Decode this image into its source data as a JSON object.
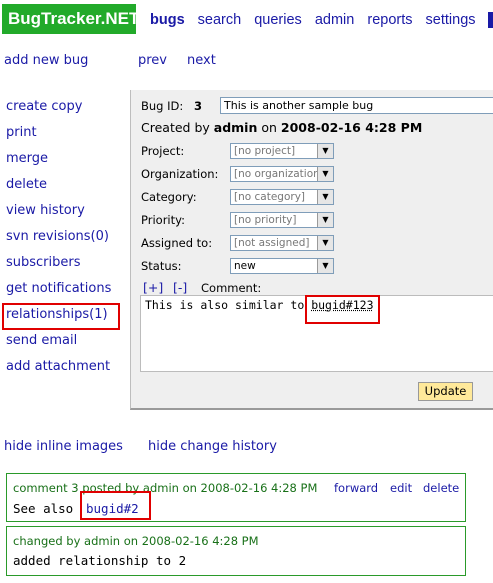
{
  "app": {
    "logo": "BugTracker.NET"
  },
  "nav": [
    "bugs",
    "search",
    "queries",
    "admin",
    "reports",
    "settings"
  ],
  "top_links": {
    "add_new": "add new bug",
    "prev": "prev",
    "next": "next"
  },
  "sidebar": [
    "create copy",
    "print",
    "merge",
    "delete",
    "view history",
    "svn revisions(0)",
    "subscribers",
    "get notifications",
    "relationships(1)",
    "send email",
    "add attachment"
  ],
  "form": {
    "bug_id_label": "Bug ID:",
    "bug_id": "3",
    "short_desc": "This is another sample bug",
    "created_by_label": "Created by",
    "created_by": "admin",
    "on_label": "on",
    "created_on": "2008-02-16 4:28 PM",
    "fields": [
      {
        "label": "Project:",
        "value": "[no project]"
      },
      {
        "label": "Organization:",
        "value": "[no organization]"
      },
      {
        "label": "Category:",
        "value": "[no category]"
      },
      {
        "label": "Priority:",
        "value": "[no priority]"
      },
      {
        "label": "Assigned to:",
        "value": "[not assigned]"
      },
      {
        "label": "Status:",
        "value": "new"
      }
    ],
    "expand": "[+]",
    "collapse": "[-]",
    "comment_label": "Comment:",
    "comment_text": "This is also similar to",
    "comment_ref": "bugid#123",
    "update_button": "Update"
  },
  "bottom_links": {
    "hide_images": "hide inline images",
    "hide_history": "hide change history"
  },
  "comments": [
    {
      "meta": "comment 3 posted by admin on 2008-02-16 4:28 PM",
      "actions": [
        "forward",
        "edit",
        "delete"
      ],
      "text": "See also",
      "link": "bugid#2"
    }
  ],
  "changes": [
    {
      "meta": "changed by admin on 2008-02-16 4:28 PM",
      "text": "added relationship to 2"
    }
  ]
}
